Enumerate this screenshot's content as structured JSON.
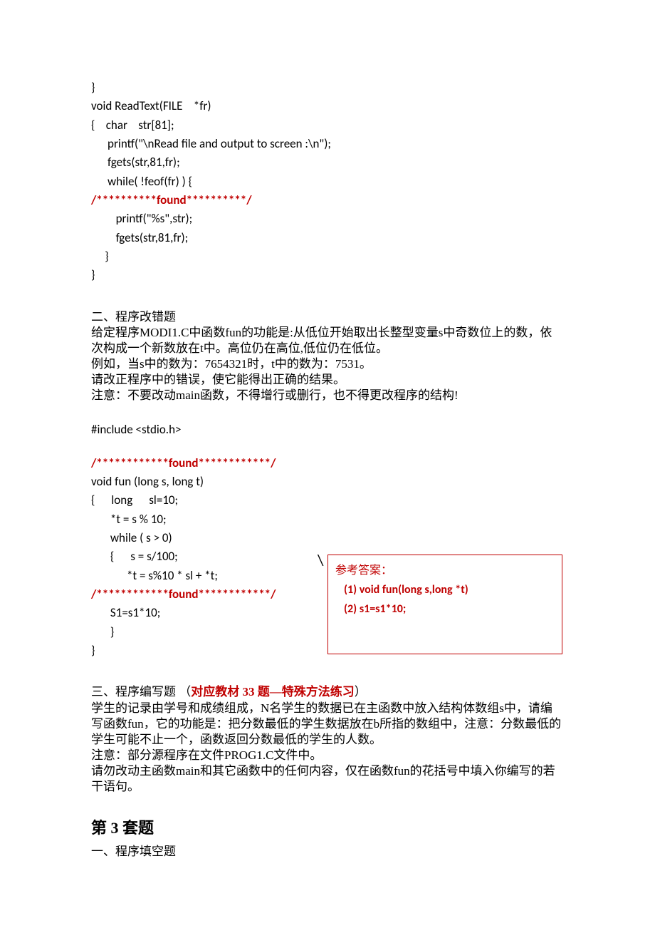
{
  "code1": {
    "l1": "}",
    "l2": "void ReadText(FILE    *fr)",
    "l3": "{    char    str[81];",
    "l4": "      printf(\"\\nRead file and output to screen :\\n\");",
    "l5": "      fgets(str,81,fr);",
    "l6": "      while( !feof(fr) ) {",
    "found1": "/**********found**********/",
    "l7": "         printf(\"%s\",str);",
    "l8": "         fgets(str,81,fr);",
    "l9": "     }",
    "l10": "}"
  },
  "section2": {
    "title": "二、程序改错题",
    "p1": "        给定程序MODI1.C中函数fun的功能是:从低位开始取出长整型变量s中奇数位上的数，依次构成一个新数放在t中。高位仍在高位,低位仍在低位。",
    "p2": "        例如，当s中的数为：7654321时，t中的数为：7531。",
    "p3": "        请改正程序中的错误，使它能得出正确的结果。",
    "p4": "        注意：不要改动main函数，不得增行或删行，也不得更改程序的结构!"
  },
  "code2": {
    "inc": "#include <stdio.h>",
    "found1": "/************found************/",
    "l1": "void fun (long s, long t)",
    "l2": "{      long      sl=10;",
    "l3": "       *t = s % 10;",
    "l4": "       while ( s > 0)",
    "l5": "       {      s = s/100;",
    "l6": "             *t = s%10 * sl + *t;",
    "found2": "/************found************/",
    "l7": "       S1=s1*10;",
    "l8": "       }",
    "l9": "}"
  },
  "answer": {
    "title": "参考答案：",
    "a1": "(1) void fun(long s,long *t)",
    "a2": "(2) s1=s1*10;"
  },
  "section3": {
    "title_a": "三、程序编写题    （",
    "title_b": "对应教材 33 题—特殊方法练习",
    "title_c": "）",
    "p1": "        学生的记录由学号和成绩组成，N名学生的数据已在主函数中放入结构体数组s中，请编写函数fun，它的功能是：把分数最低的学生数据放在b所指的数组中，注意：分数最低的学生可能不止一个，函数返回分数最低的学生的人数。",
    "p2": "        注意：部分源程序在文件PROG1.C文件中。",
    "p3": "        请勿改动主函数main和其它函数中的任何内容，仅在函数fun的花括号中填入你编写的若干语句。"
  },
  "heading": "第 3 套题",
  "section1b": "一、程序填空题"
}
